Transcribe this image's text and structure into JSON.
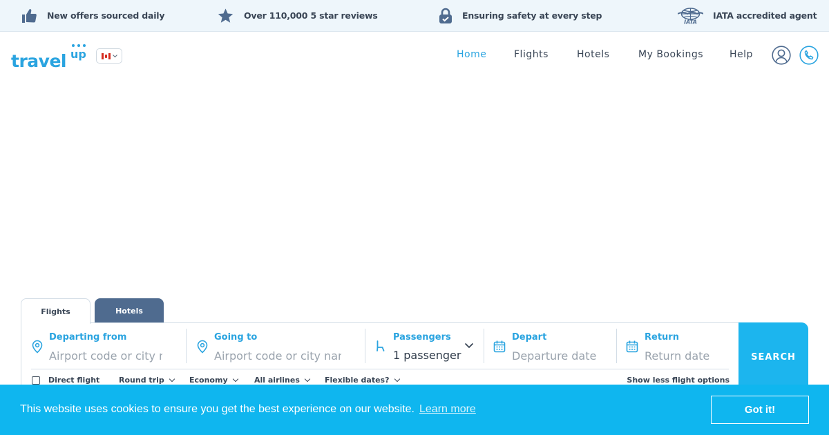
{
  "trust_bar": {
    "items": [
      {
        "icon": "thumbs-up-icon",
        "text": "New offers sourced daily"
      },
      {
        "icon": "star-icon",
        "text": "Over 110,000 5 star reviews"
      },
      {
        "icon": "lock-icon",
        "text": "Ensuring safety at every step"
      },
      {
        "icon": "iata-logo-icon",
        "text": "IATA accredited agent"
      }
    ]
  },
  "header": {
    "logo_text": "travel",
    "logo_superscript": "up",
    "language_flag": "canada-flag-icon",
    "nav": [
      {
        "label": "Home",
        "active": true
      },
      {
        "label": "Flights",
        "active": false
      },
      {
        "label": "Hotels",
        "active": false
      },
      {
        "label": "My Bookings",
        "active": false
      },
      {
        "label": "Help",
        "active": false
      }
    ]
  },
  "search": {
    "tabs": [
      {
        "label": "Flights",
        "active": true
      },
      {
        "label": "Hotels",
        "active": false
      }
    ],
    "departing": {
      "label": "Departing from",
      "placeholder": "Airport code or city name"
    },
    "going": {
      "label": "Going to",
      "placeholder": "Airport code or city name"
    },
    "passengers": {
      "label": "Passengers",
      "value": "1 passenger"
    },
    "depart": {
      "label": "Depart",
      "placeholder": "Departure date"
    },
    "return": {
      "label": "Return",
      "placeholder": "Return date"
    },
    "options": {
      "direct_flight": "Direct flight",
      "trip_type": "Round trip",
      "cabin_class": "Economy",
      "airlines": "All airlines",
      "flexible_dates": "Flexible dates?",
      "toggle_options": "Show less flight options"
    },
    "search_button": "SEARCH"
  },
  "cookie_banner": {
    "message": "This website uses cookies to ensure you get the best experience on our website.",
    "learn_more": "Learn more",
    "accept": "Got it!"
  },
  "colors": {
    "accent": "#2aa4e0",
    "search_button": "#1cb5ee",
    "cookie_banner": "#0fb6ef",
    "hotels_tab": "#4f6b8f",
    "trust_bar_bg": "#eef6fb"
  }
}
